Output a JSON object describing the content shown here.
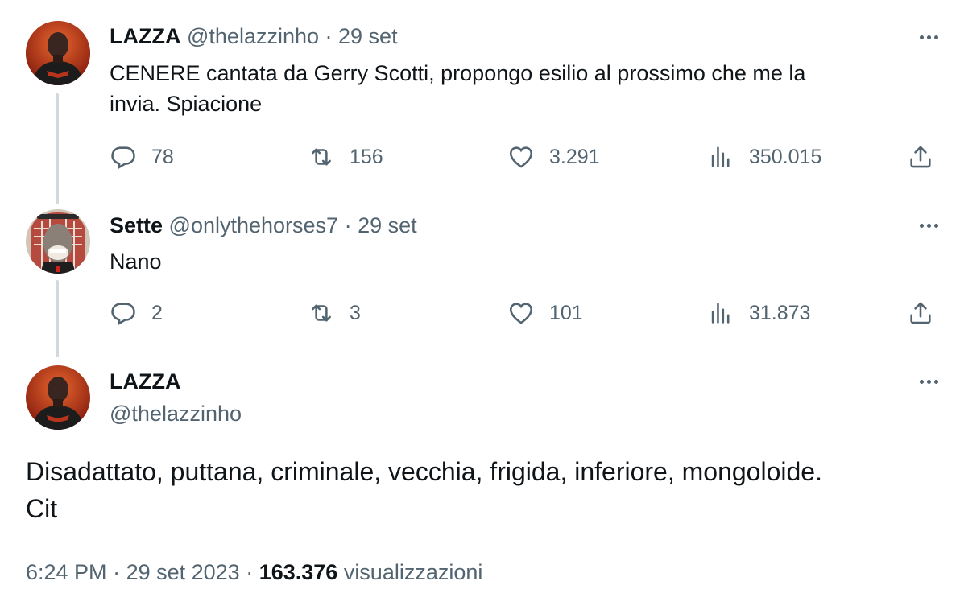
{
  "tweets": [
    {
      "name": "LAZZA",
      "handle": "@thelazzinho",
      "separator": " · ",
      "date": "29 set",
      "text_line1": "CENERE cantata da Gerry Scotti, propongo esilio al prossimo che me la",
      "text_line2": "invia. Spiacione",
      "replies": "78",
      "retweets": "156",
      "likes": "3.291",
      "views": "350.015"
    },
    {
      "name": "Sette",
      "handle": "@onlythehorses7",
      "separator": " · ",
      "date": "29 set",
      "text_line1": "Nano",
      "replies": "2",
      "retweets": "3",
      "likes": "101",
      "views": "31.873"
    }
  ],
  "main_tweet": {
    "name": "LAZZA",
    "handle": "@thelazzinho",
    "text_line1": "Disadattato, puttana, criminale, vecchia, frigida, inferiore, mongoloide.",
    "text_line2": "Cit",
    "time": "6:24 PM",
    "date": "29 set 2023",
    "sep": " · ",
    "views": "163.376",
    "views_label": "visualizzazioni"
  },
  "icons": {
    "reply": "reply-icon",
    "retweet": "retweet-icon",
    "like": "heart-icon",
    "views": "views-icon",
    "share": "share-icon",
    "more": "more-icon"
  },
  "colors": {
    "text": "#0f1419",
    "secondary": "#536471",
    "thread_line": "#cfd9de"
  }
}
